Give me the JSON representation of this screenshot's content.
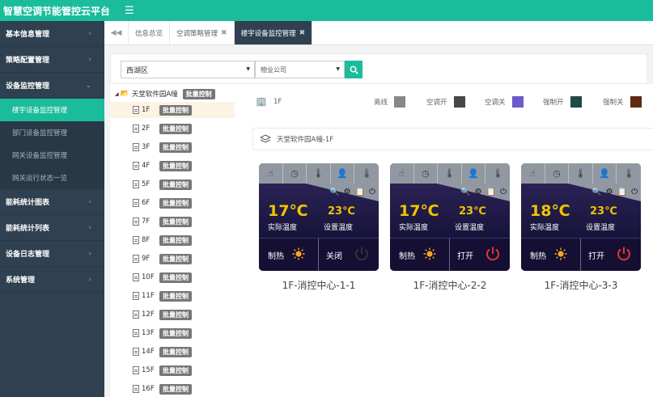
{
  "header": {
    "title": "智慧空调节能管控云平台",
    "menu_icon": "hamburger-icon"
  },
  "sidebar": {
    "items": [
      {
        "label": "基本信息管理",
        "chevron": "›"
      },
      {
        "label": "策略配置管理",
        "chevron": "›"
      },
      {
        "label": "设备监控管理",
        "chevron": "⌄"
      },
      {
        "label": "能耗统计图表",
        "chevron": "›"
      },
      {
        "label": "能耗统计列表",
        "chevron": "›"
      },
      {
        "label": "设备日志管理",
        "chevron": "›"
      },
      {
        "label": "系统管理",
        "chevron": "›"
      }
    ],
    "sub_items": [
      {
        "label": "楼宇设备监控管理"
      },
      {
        "label": "部门设备监控管理"
      },
      {
        "label": "网关设备监控管理"
      },
      {
        "label": "网关运行状态一览"
      }
    ]
  },
  "tabs": {
    "nav_prev": "◀◀",
    "items": [
      {
        "label": "信息总览",
        "close": ""
      },
      {
        "label": "空调策略管理",
        "close": "✖"
      },
      {
        "label": "楼宇设备监控管理",
        "close": "✖"
      }
    ]
  },
  "filter": {
    "district": "西湖区",
    "company_placeholder": "物业公司",
    "caret": "▼"
  },
  "tree": {
    "root_label": "天堂软件园A幢",
    "root_badge": "批量控制",
    "badge_label": "批量控制",
    "floors": [
      "1F",
      "2F",
      "3F",
      "4F",
      "5F",
      "6F",
      "7F",
      "8F",
      "9F",
      "10F",
      "11F",
      "12F",
      "13F",
      "14F",
      "15F",
      "16F"
    ]
  },
  "legend": {
    "floor": "1F",
    "items": [
      {
        "label": "离线",
        "color": "#888888"
      },
      {
        "label": "空调开",
        "color": "#484848"
      },
      {
        "label": "空调关",
        "color": "#6a5acd"
      },
      {
        "label": "强制开",
        "color": "#1e4a4a"
      },
      {
        "label": "强制关",
        "color": "#5e2a12"
      }
    ]
  },
  "breadcrumb": "天堂软件园A幢-1F",
  "device_labels": {
    "actual": "实际温度",
    "set": "设置温度"
  },
  "devices": [
    {
      "name": "1F-消控中心-1-1",
      "actual_temp": "17℃",
      "set_temp": "23℃",
      "mode": "制热",
      "power_label": "关闭",
      "power_on": false
    },
    {
      "name": "1F-消控中心-2-2",
      "actual_temp": "17℃",
      "set_temp": "23℃",
      "mode": "制热",
      "power_label": "打开",
      "power_on": true
    },
    {
      "name": "1F-消控中心-3-3",
      "actual_temp": "18℃",
      "set_temp": "23℃",
      "mode": "制热",
      "power_label": "打开",
      "power_on": true
    }
  ],
  "colors": {
    "accent": "#1abc9c",
    "sidebar": "#2f4050",
    "power_on": "#e8342b",
    "power_off": "#333333",
    "temp": "#f2c300",
    "sun": "#f5a623"
  }
}
